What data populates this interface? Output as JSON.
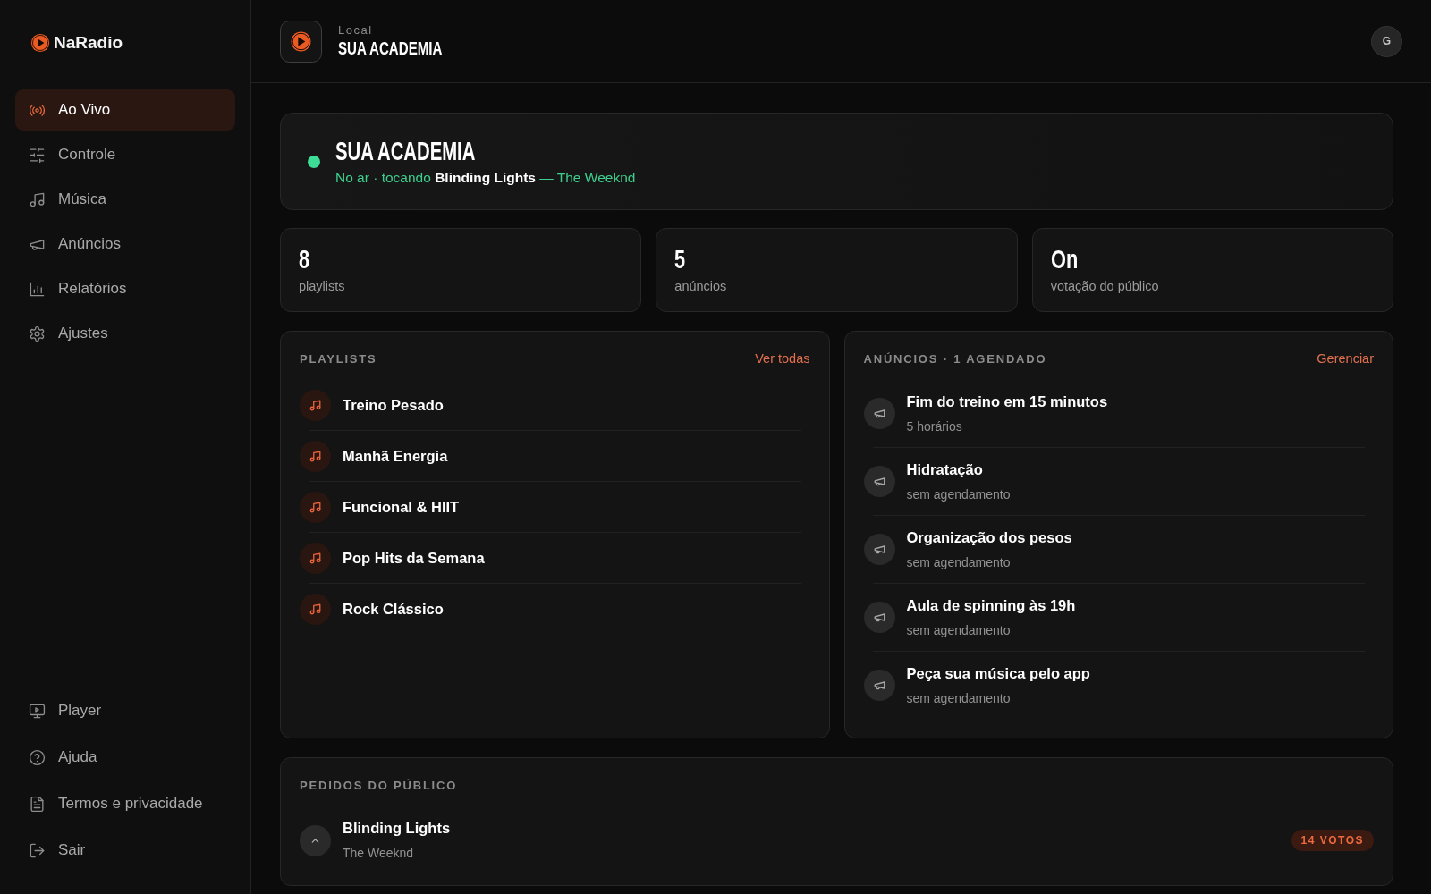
{
  "sidebar": {
    "brand": "NaRadio",
    "nav_items": [
      {
        "label": "Ao Vivo",
        "selected": true
      },
      {
        "label": "Controle",
        "selected": false
      },
      {
        "label": "Música",
        "selected": false
      },
      {
        "label": "Anúncios",
        "selected": false
      },
      {
        "label": "Relatórios",
        "selected": false
      },
      {
        "label": "Ajustes",
        "selected": false
      }
    ],
    "footer_items": [
      {
        "label": "Player"
      },
      {
        "label": "Ajuda"
      },
      {
        "label": "Termos e privacidade"
      },
      {
        "label": "Sair"
      }
    ]
  },
  "header": {
    "eyebrow": "Local",
    "title": "SUA ACADEMIA",
    "avatar": "G"
  },
  "status_card": {
    "on_air": true,
    "title": "SUA ACADEMIA",
    "now_playing": "No ar · tocando **Blinding Lights** — The Weeknd"
  },
  "stats": [
    {
      "value": "8",
      "label": "playlists"
    },
    {
      "value": "5",
      "label": "anúncios"
    },
    {
      "value": "On",
      "label": "votação do público"
    }
  ],
  "playlists": {
    "title": "PLAYLISTS",
    "link": "Ver todas",
    "items": [
      {
        "name": "Treino Pesado"
      },
      {
        "name": "Manhã Energia"
      },
      {
        "name": "Funcional & HIIT"
      },
      {
        "name": "Pop Hits da Semana"
      },
      {
        "name": "Rock Clássico"
      }
    ]
  },
  "announcements": {
    "title": "ANÚNCIOS · 1 AGENDADO",
    "link": "Gerenciar",
    "items": [
      {
        "title": "Fim do treino em 15 minutos",
        "schedule": "5 horários"
      },
      {
        "title": "Hidratação",
        "schedule": "sem agendamento"
      },
      {
        "title": "Organização dos pesos",
        "schedule": "sem agendamento"
      },
      {
        "title": "Aula de spinning às 19h",
        "schedule": "sem agendamento"
      },
      {
        "title": "Peça sua música pelo app",
        "schedule": "sem agendamento"
      }
    ]
  },
  "requests": {
    "title": "PEDIDOS DO PÚBLICO",
    "items": [
      {
        "title": "Blinding Lights",
        "artist": "The Weeknd",
        "votes": "14 VOTOS"
      }
    ]
  }
}
